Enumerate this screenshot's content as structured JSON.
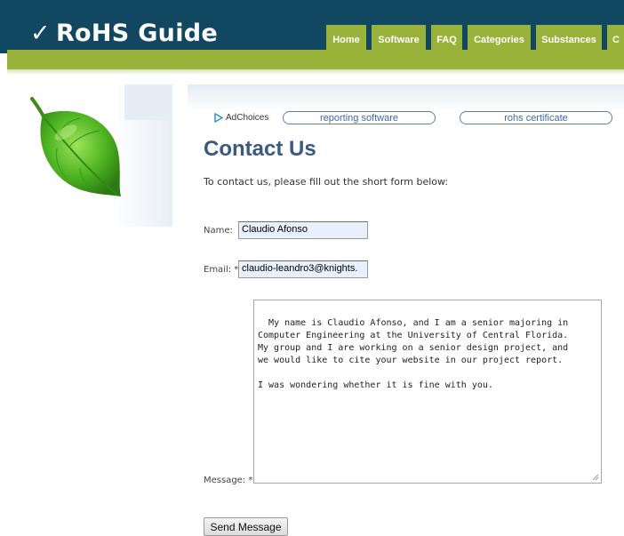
{
  "site": {
    "logo_check": "✓",
    "logo_text": "RoHS Guide"
  },
  "nav": {
    "items": [
      {
        "label": "Home"
      },
      {
        "label": "Software"
      },
      {
        "label": "FAQ"
      },
      {
        "label": "Categories"
      },
      {
        "label": "Substances"
      },
      {
        "label": "C"
      }
    ]
  },
  "ads": {
    "adchoices_label": "AdChoices",
    "links": [
      {
        "label": "reporting software"
      },
      {
        "label": "rohs certificate"
      }
    ]
  },
  "page": {
    "title": "Contact Us",
    "intro": "To contact us, please fill out the short form below:"
  },
  "form": {
    "name_label": "Name:",
    "name_value": "Claudio Afonso",
    "email_label": "Email: *",
    "email_value": "claudio-leandro3@knights.",
    "message_label": "Message: *",
    "message_value": "My name is Claudio Afonso, and I am a senior majoring in\nComputer Engineering at the University of Central Florida.\nMy group and I are working on a senior design project, and\nwe would like to cite your website in our project report.\n\nI was wondering whether it is fine with you.",
    "submit_label": "Send Message"
  },
  "colors": {
    "header_bg": "#114760",
    "accent_green": "#99b23a",
    "title_blue": "#3a5a7e",
    "link_blue": "#3f6aa5"
  }
}
